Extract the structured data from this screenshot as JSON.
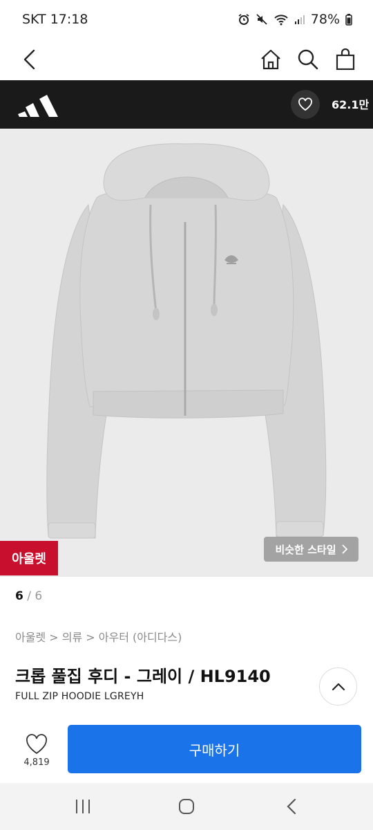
{
  "status_bar": {
    "carrier_time": "SKT 17:18",
    "battery": "78%"
  },
  "header": {
    "icons": [
      "back-icon",
      "home-icon",
      "search-icon",
      "bag-icon"
    ]
  },
  "brand_bar": {
    "logo": "adidas-logo",
    "like_count": "62.1만"
  },
  "product_image": {
    "badge": "아울렛",
    "similar_style": "비슷한 스타일",
    "current_page": "6",
    "page_sep": " / ",
    "total_pages": "6"
  },
  "product": {
    "breadcrumb": "아울렛 > 의류 > 아우터 (아디다스)",
    "title": "크롭 풀집 후디 - 그레이 / HL9140",
    "subtitle": "FULL ZIP HOODIE LGREYH"
  },
  "actions": {
    "like_count": "4,819",
    "buy_label": "구매하기"
  },
  "colors": {
    "brand_bar": "#1a1a1a",
    "outlet_badge": "#c8102e",
    "buy_button": "#1a73e8"
  }
}
